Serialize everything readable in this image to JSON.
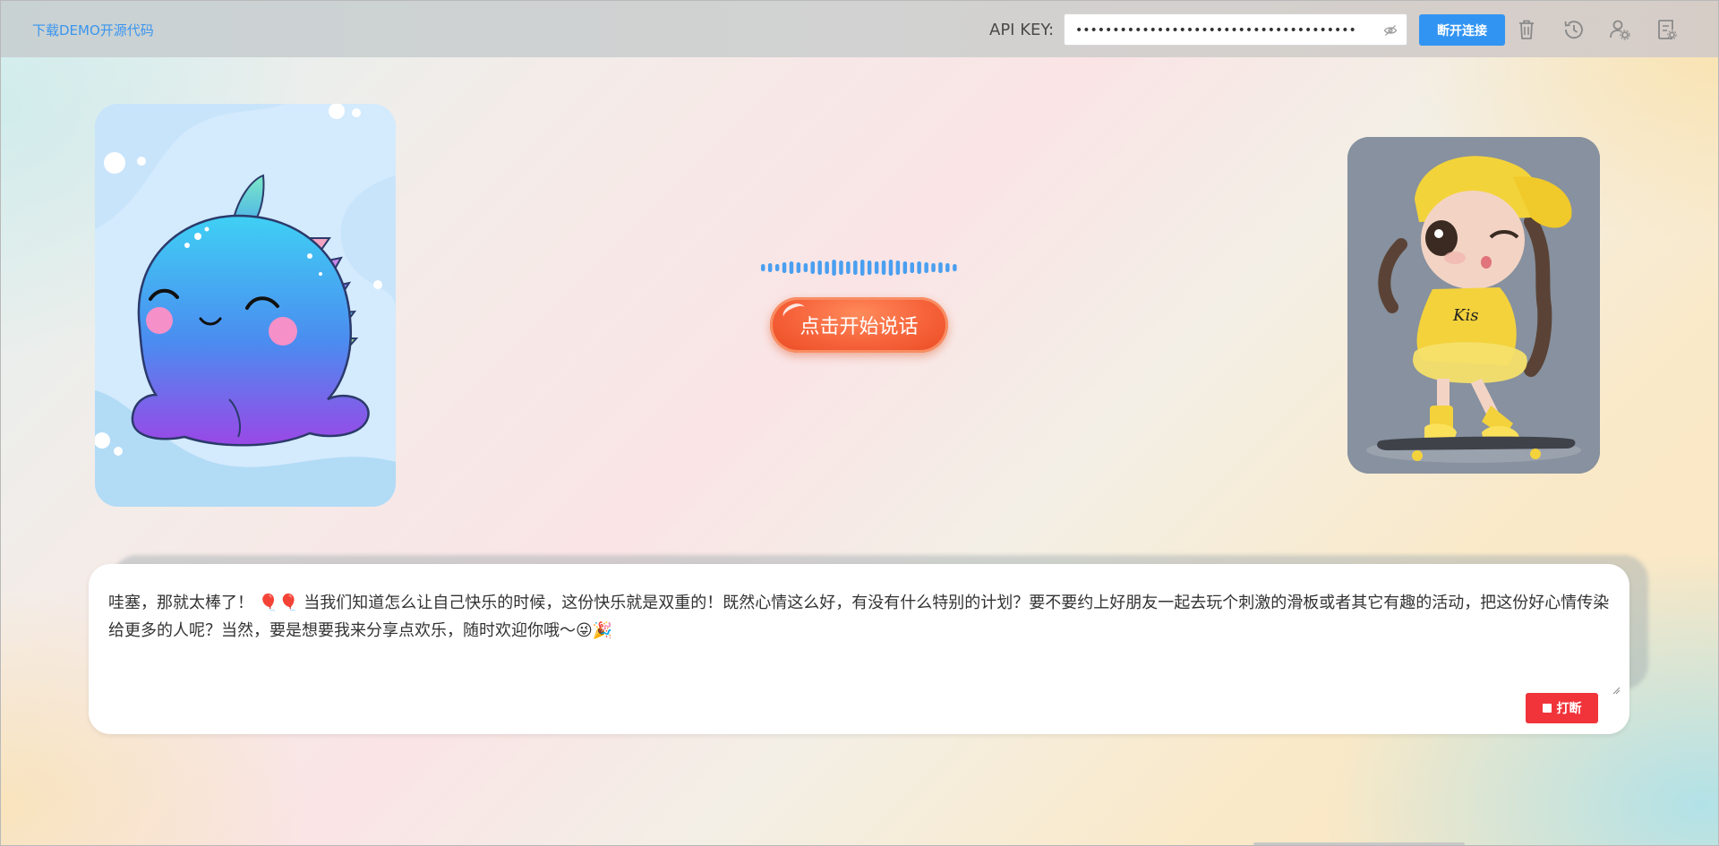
{
  "header": {
    "demo_link": "下载DEMO开源代码",
    "api_key_label": "API KEY:",
    "api_key_value": "••••••••••••••••••••••••••••••••••••••",
    "disconnect_label": "断开连接",
    "icons": [
      "trash-icon",
      "history-icon",
      "user-settings-icon",
      "notes-icon"
    ]
  },
  "main": {
    "talk_button_label": "点击开始说话"
  },
  "chat": {
    "message": "哇塞，那就太棒了！ 🎈🎈 当我们知道怎么让自己快乐的时候，这份快乐就是双重的！既然心情这么好，有没有什么特别的计划？要不要约上好朋友一起去玩个刺激的滑板或者其它有趣的活动，把这份好心情传染给更多的人呢？当然，要是想要我来分享点欢乐，随时欢迎你哦～😜🎉",
    "interrupt_label": "打断"
  },
  "colors": {
    "primary": "#3294f2",
    "talk_button": "#f6623a",
    "interrupt": "#f0343a",
    "link": "#3b95ee"
  }
}
